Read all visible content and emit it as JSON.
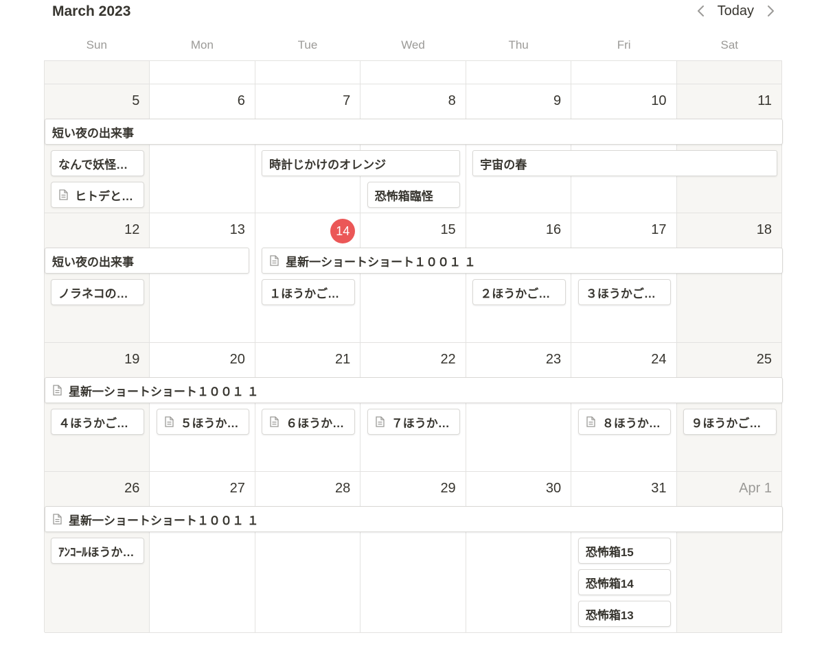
{
  "header": {
    "month_title": "March 2023",
    "today_label": "Today",
    "prev_icon": "chevron-left-icon",
    "next_icon": "chevron-right-icon"
  },
  "weekdays": [
    "Sun",
    "Mon",
    "Tue",
    "Wed",
    "Thu",
    "Fri",
    "Sat"
  ],
  "weeks": [
    {
      "days": [
        "",
        "",
        "",
        "",
        "",
        "",
        ""
      ]
    },
    {
      "days": [
        "5",
        "6",
        "7",
        "8",
        "9",
        "10",
        "11"
      ]
    },
    {
      "days": [
        "12",
        "13",
        "14",
        "15",
        "16",
        "17",
        "18"
      ]
    },
    {
      "days": [
        "19",
        "20",
        "21",
        "22",
        "23",
        "24",
        "25"
      ]
    },
    {
      "days": [
        "26",
        "27",
        "28",
        "29",
        "30",
        "31",
        "Apr 1"
      ]
    }
  ],
  "today_date": "14",
  "events": [
    {
      "label": "短い夜の出来事",
      "week": 1,
      "start": 0,
      "span": 7,
      "row": 0,
      "icon": false
    },
    {
      "label": "なんで妖怪…",
      "week": 1,
      "start": 0,
      "span": 1,
      "row": 1,
      "icon": false
    },
    {
      "label": "時計じかけのオレンジ",
      "week": 1,
      "start": 2,
      "span": 2,
      "row": 1,
      "icon": false
    },
    {
      "label": "宇宙の春",
      "week": 1,
      "start": 4,
      "span": 3,
      "row": 1,
      "icon": false
    },
    {
      "label": "ヒトデと…",
      "week": 1,
      "start": 0,
      "span": 1,
      "row": 2,
      "icon": true
    },
    {
      "label": "恐怖箱臨怪",
      "week": 1,
      "start": 3,
      "span": 1,
      "row": 2,
      "icon": false
    },
    {
      "label": "短い夜の出来事",
      "week": 2,
      "start": 0,
      "span": 2,
      "row": 0,
      "icon": false
    },
    {
      "label": "星新一ショートショート１００１ １",
      "week": 2,
      "start": 2,
      "span": 5,
      "row": 0,
      "icon": true
    },
    {
      "label": "ノラネコの…",
      "week": 2,
      "start": 0,
      "span": 1,
      "row": 1,
      "icon": false
    },
    {
      "label": "１ほうかご…",
      "week": 2,
      "start": 2,
      "span": 1,
      "row": 1,
      "icon": false
    },
    {
      "label": "２ほうかご…",
      "week": 2,
      "start": 4,
      "span": 1,
      "row": 1,
      "icon": false
    },
    {
      "label": "３ほうかご…",
      "week": 2,
      "start": 5,
      "span": 1,
      "row": 1,
      "icon": false
    },
    {
      "label": "星新一ショートショート１００１ １",
      "week": 3,
      "start": 0,
      "span": 7,
      "row": 0,
      "icon": true
    },
    {
      "label": "４ほうかご…",
      "week": 3,
      "start": 0,
      "span": 1,
      "row": 1,
      "icon": false
    },
    {
      "label": "５ほうか…",
      "week": 3,
      "start": 1,
      "span": 1,
      "row": 1,
      "icon": true
    },
    {
      "label": "６ほうか…",
      "week": 3,
      "start": 2,
      "span": 1,
      "row": 1,
      "icon": true
    },
    {
      "label": "７ほうか…",
      "week": 3,
      "start": 3,
      "span": 1,
      "row": 1,
      "icon": true
    },
    {
      "label": "８ほうか…",
      "week": 3,
      "start": 5,
      "span": 1,
      "row": 1,
      "icon": true
    },
    {
      "label": "９ほうかご…",
      "week": 3,
      "start": 6,
      "span": 1,
      "row": 1,
      "icon": false
    },
    {
      "label": "星新一ショートショート１００１ １",
      "week": 4,
      "start": 0,
      "span": 7,
      "row": 0,
      "icon": true
    },
    {
      "label": "ｱﾝｺｰﾙほうか…",
      "week": 4,
      "start": 0,
      "span": 1,
      "row": 1,
      "icon": false
    },
    {
      "label": "恐怖箱15",
      "week": 4,
      "start": 5,
      "span": 1,
      "row": 1,
      "icon": false
    },
    {
      "label": "恐怖箱14",
      "week": 4,
      "start": 5,
      "span": 1,
      "row": 2,
      "icon": false
    },
    {
      "label": "恐怖箱13",
      "week": 4,
      "start": 5,
      "span": 1,
      "row": 3,
      "icon": false
    }
  ]
}
